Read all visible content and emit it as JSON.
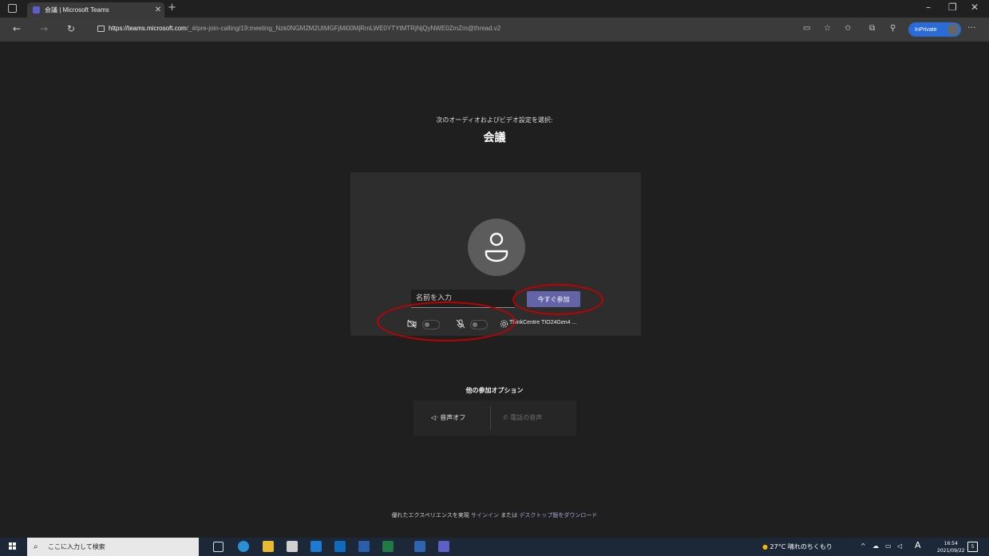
{
  "browser": {
    "tab_title": "会議 | Microsoft Teams",
    "url_host": "https://teams.microsoft.com",
    "url_path": "/_#/pre-join-calling/19:meeting_Nzk0NGM2M2UtMGFjMi00MjRmLWE0YTYtMTRjNjQyNWE0ZmZm@thread.v2",
    "inprivate_label": "InPrivate"
  },
  "prejoin": {
    "subtitle": "次のオーディオおよびビデオ設定を選択:",
    "meeting_title": "会議",
    "name_placeholder": "名前を入力",
    "join_button": "今すぐ参加",
    "device_name": "ThinkCentre TIO24Gen4 ..."
  },
  "other_options": {
    "heading": "他の参加オプション",
    "audio_off": "音声オフ",
    "phone_audio": "電話の音声"
  },
  "footer": {
    "prefix": "優れたエクスペリエンスを実現",
    "signin": "サインイン",
    "or": "または",
    "desktop": "デスクトップ版をダウンロード"
  },
  "taskbar": {
    "search_placeholder": "ここに入力して検索",
    "weather": "27°C 晴れのちくもり",
    "ime": "A",
    "time": "16:54",
    "date": "2021/09/22",
    "notification_count": "5"
  },
  "colors": {
    "accent": "#6264a7",
    "annotation": "#c00000",
    "link": "#a6a7dc"
  }
}
